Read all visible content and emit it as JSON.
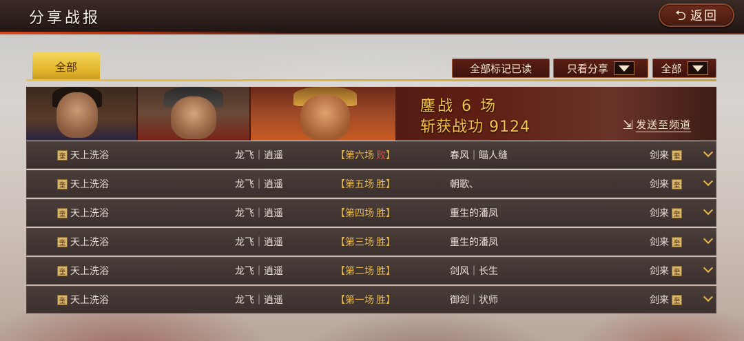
{
  "header": {
    "title": "分享战报",
    "back_label": "返回"
  },
  "filters": {
    "tab_all": "全部",
    "mark_all_read": "全部标记已读",
    "only_shared": "只看分享",
    "scope_select": "全部"
  },
  "banner": {
    "battles_label": "鏖战 6 场",
    "merit_label": "斩获战功 9124",
    "send_to_channel": "发送至频道"
  },
  "battles": [
    {
      "player": "天上洗浴",
      "team": "龙飞｜逍遥",
      "round": "【第六场",
      "result": "败",
      "close": "】",
      "opponent": "春风｜瞄人缝",
      "opp_server": "剑来",
      "lost": true
    },
    {
      "player": "天上洗浴",
      "team": "龙飞｜逍遥",
      "round": "【第五场",
      "result": "胜",
      "close": "】",
      "opponent": "朝歌、",
      "opp_server": "剑来",
      "lost": false
    },
    {
      "player": "天上洗浴",
      "team": "龙飞｜逍遥",
      "round": "【第四场",
      "result": "胜",
      "close": "】",
      "opponent": "重生的潘凤",
      "opp_server": "剑来",
      "lost": false
    },
    {
      "player": "天上洗浴",
      "team": "龙飞｜逍遥",
      "round": "【第三场",
      "result": "胜",
      "close": "】",
      "opponent": "重生的潘凤",
      "opp_server": "剑来",
      "lost": false
    },
    {
      "player": "天上洗浴",
      "team": "龙飞｜逍遥",
      "round": "【第二场",
      "result": "胜",
      "close": "】",
      "opponent": "剑风｜长生",
      "opp_server": "剑来",
      "lost": false
    },
    {
      "player": "天上洗浴",
      "team": "龙飞｜逍遥",
      "round": "【第一场",
      "result": "胜",
      "close": "】",
      "opponent": "御剑｜状师",
      "opp_server": "剑来",
      "lost": false
    }
  ],
  "badge_glyph": "奎",
  "icons": {
    "back": "back-arrow-icon",
    "dropdown": "triangle-down-icon",
    "send": "export-icon",
    "expand": "chevron-down-icon",
    "server_badge": "server-badge-icon"
  },
  "colors": {
    "accent_gold": "#e8b84a",
    "lose_red": "#e0503a",
    "tab_yellow": "#f4d55c"
  }
}
